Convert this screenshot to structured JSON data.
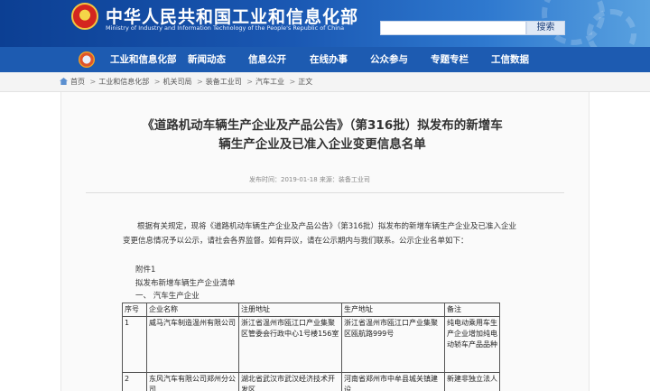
{
  "header": {
    "title": "中华人民共和国工业和信息化部",
    "subtitle": "Ministry of Industry and Information Technology of the People's Republic of China",
    "search_button": "搜索",
    "search_value": ""
  },
  "nav": {
    "items": [
      "工业和信息化部",
      "新闻动态",
      "信息公开",
      "在线办事",
      "公众参与",
      "专题专栏",
      "工信数据"
    ]
  },
  "breadcrumb": {
    "items": [
      "首页",
      "工业和信息化部",
      "机关司局",
      "装备工业司",
      "汽车工业",
      "正文"
    ],
    "separator": ">"
  },
  "article": {
    "title_line1": "《道路机动车辆生产企业及产品公告》（第316批）拟发布的新增车",
    "title_line2": "辆生产企业及已准入企业变更信息名单",
    "meta": "发布时间：2019-01-18  来源：装备工业司",
    "paragraph": "根据有关规定，现将《道路机动车辆生产企业及产品公告》（第316批）拟发布的新增车辆生产企业及已准入企业变更信息情况予以公示，请社会各界监督。如有异议，请在公示期内与我们联系。公示企业名单如下：",
    "attachment": "附件1",
    "list_title": "拟发布新增车辆生产企业清单",
    "section": "一、 汽车生产企业"
  },
  "table": {
    "headers": [
      "序号",
      "企业名称",
      "注册地址",
      "生产地址",
      "备注"
    ],
    "rows": [
      [
        "1",
        "威马汽车制造温州有限公司",
        "浙江省温州市瓯江口产业集聚区管委会行政中心1号楼156室",
        "浙江省温州市瓯江口产业集聚区瓯航路999号",
        "纯电动乘用车生产企业增加纯电动轿车产品品种"
      ],
      [
        "2",
        "东风汽车有限公司郑州分公司",
        "湖北省武汉市武汉经济技术开发区",
        "河南省郑州市中牟县城关镇建设",
        "新建非独立法人"
      ]
    ]
  },
  "colors": {
    "header_dark": "#0c3f93",
    "header_light": "#5aa2e0",
    "nav_bg": "#1d5bb1",
    "crumb_bg": "#f4f4f4"
  }
}
